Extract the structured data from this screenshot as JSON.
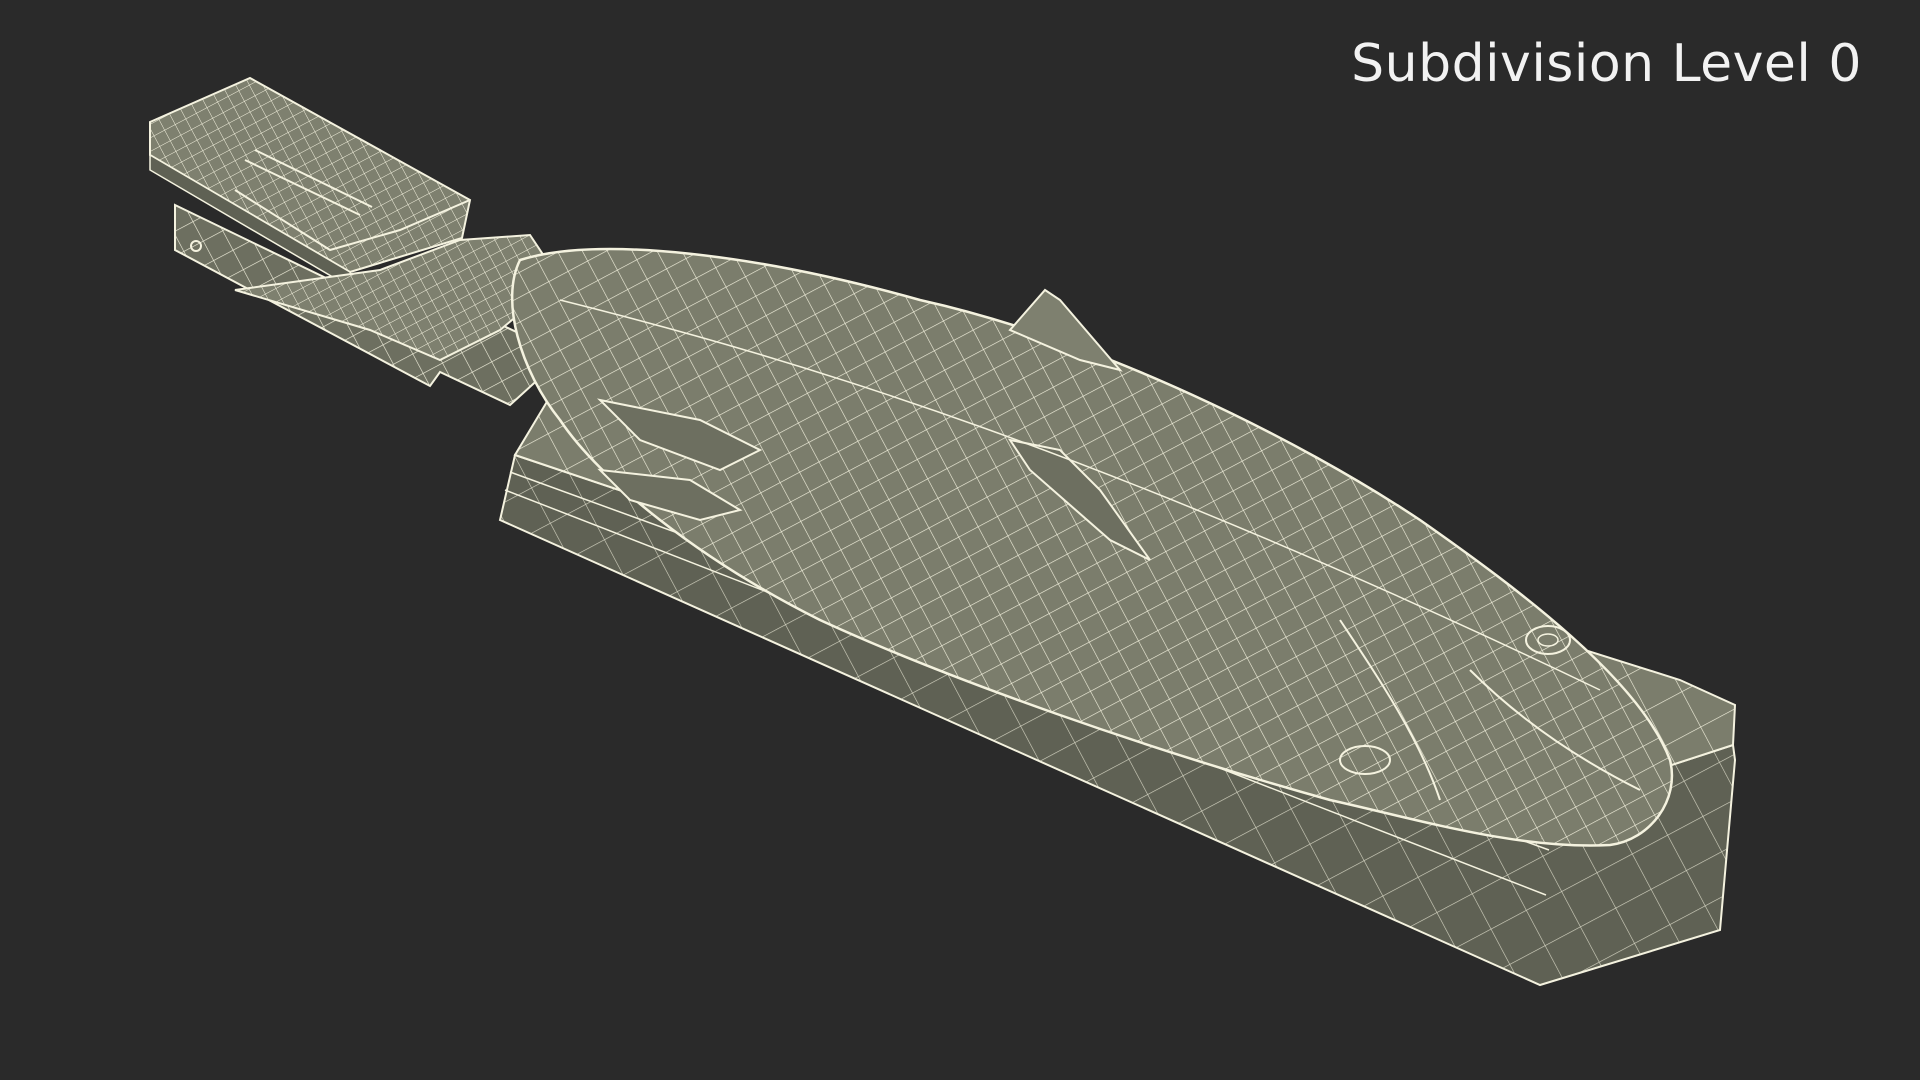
{
  "overlay": {
    "label": "Subdivision Level 0"
  },
  "colors": {
    "background": "#2a2a2a",
    "mesh_fill": "#7b7d6c",
    "mesh_fill_dark": "#5f6154",
    "wire": "#f4f2df"
  },
  "model": {
    "subject": "fish-on-board-with-clip",
    "display_mode": "wireframe-on-shaded"
  }
}
